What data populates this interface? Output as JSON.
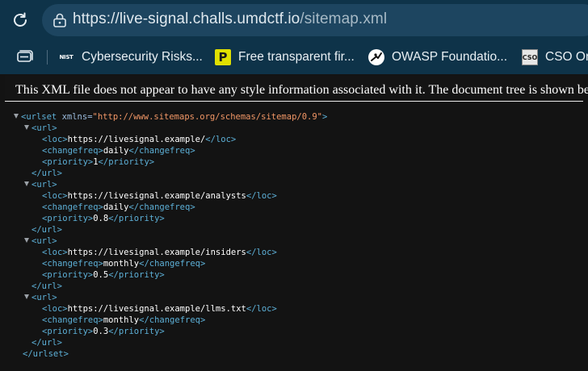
{
  "browser": {
    "url_host": "https://live-signal.challs.umdctf.io",
    "url_path": "/sitemap.xml"
  },
  "bookmarks": [
    {
      "label": "Cybersecurity Risks...",
      "icon": "nist-icon"
    },
    {
      "label": "Free transparent fir...",
      "icon": "p-logo-icon"
    },
    {
      "label": "OWASP Foundatio...",
      "icon": "owasp-icon"
    },
    {
      "label": "CSO Onl",
      "icon": "cso-icon"
    }
  ],
  "notice": "This XML file does not appear to have any style information associated with it. The document tree is shown below.",
  "xml": {
    "root_open": "<urlset",
    "root_attr": "xmlns=",
    "root_attr_value": "\"http://www.sitemaps.org/schemas/sitemap/0.9\"",
    "root_gt": ">",
    "root_close": "</urlset>",
    "url_open": "<url>",
    "url_close": "</url>",
    "loc_open": "<loc>",
    "loc_close": "</loc>",
    "changefreq_open": "<changefreq>",
    "changefreq_close": "</changefreq>",
    "priority_open": "<priority>",
    "priority_close": "</priority>",
    "entries": [
      {
        "loc": "https://livesignal.example/",
        "changefreq": "daily",
        "priority": "1"
      },
      {
        "loc": "https://livesignal.example/analysts",
        "changefreq": "daily",
        "priority": "0.8"
      },
      {
        "loc": "https://livesignal.example/insiders",
        "changefreq": "monthly",
        "priority": "0.5"
      },
      {
        "loc": "https://livesignal.example/llms.txt",
        "changefreq": "monthly",
        "priority": "0.3"
      }
    ]
  }
}
